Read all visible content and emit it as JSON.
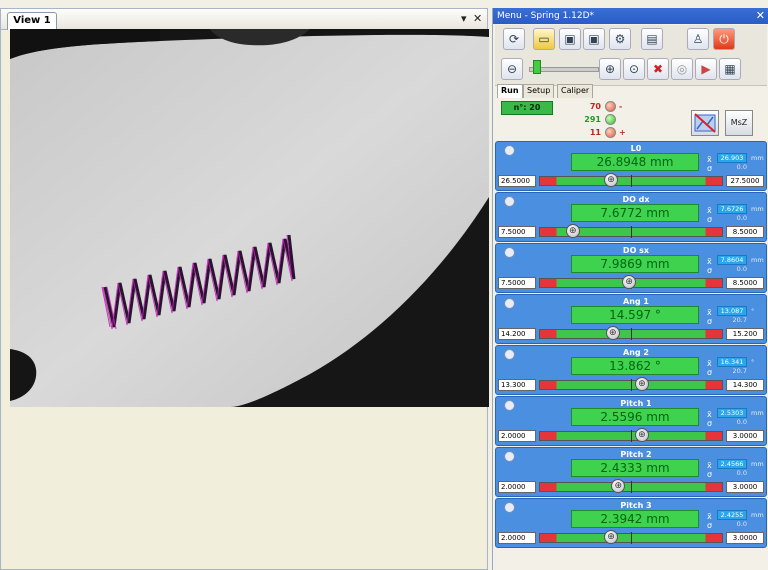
{
  "view": {
    "tab_label": "View 1",
    "pin_icon": "▾",
    "close_icon": "✕"
  },
  "menu": {
    "title": "Menu - Spring 1.12D*",
    "close_icon": "✕",
    "tabs": [
      "Run",
      "Setup",
      "Caliper"
    ],
    "counter": "n°: 20",
    "counts": [
      {
        "value": "70",
        "sign": "-",
        "status": "red"
      },
      {
        "value": "291",
        "sign": "",
        "status": "green"
      },
      {
        "value": "11",
        "sign": "+",
        "status": "red"
      }
    ],
    "msz_label": "MsZ"
  },
  "measures": [
    {
      "name": "L0",
      "value": "26.8948 mm",
      "mean": "26.903",
      "sd": "0.0",
      "unit": "mm",
      "min": "26.5000",
      "max": "27.5000",
      "position": 0.39
    },
    {
      "name": "DO dx",
      "value": "7.6772 mm",
      "mean": "7.6726",
      "sd": "0.0",
      "unit": "mm",
      "min": "7.5000",
      "max": "8.5000",
      "position": 0.18
    },
    {
      "name": "DO sx",
      "value": "7.9869 mm",
      "mean": "7.8604",
      "sd": "0.0",
      "unit": "mm",
      "min": "7.5000",
      "max": "8.5000",
      "position": 0.49
    },
    {
      "name": "Ang 1",
      "value": "14.597 °",
      "mean": "13.087",
      "sd": "20.7",
      "unit": "°",
      "min": "14.200",
      "max": "15.200",
      "position": 0.4
    },
    {
      "name": "Ang 2",
      "value": "13.862 °",
      "mean": "16.341",
      "sd": "20.7",
      "unit": "°",
      "min": "13.300",
      "max": "14.300",
      "position": 0.56
    },
    {
      "name": "Pitch 1",
      "value": "2.5596 mm",
      "mean": "2.5303",
      "sd": "0.0",
      "unit": "mm",
      "min": "2.0000",
      "max": "3.0000",
      "position": 0.56
    },
    {
      "name": "Pitch 2",
      "value": "2.4333 mm",
      "mean": "2.4566",
      "sd": "0.0",
      "unit": "mm",
      "min": "2.0000",
      "max": "3.0000",
      "position": 0.43
    },
    {
      "name": "Pitch 3",
      "value": "2.3942 mm",
      "mean": "2.4255",
      "sd": "0.0",
      "unit": "mm",
      "min": "2.0000",
      "max": "3.0000",
      "position": 0.39
    }
  ]
}
